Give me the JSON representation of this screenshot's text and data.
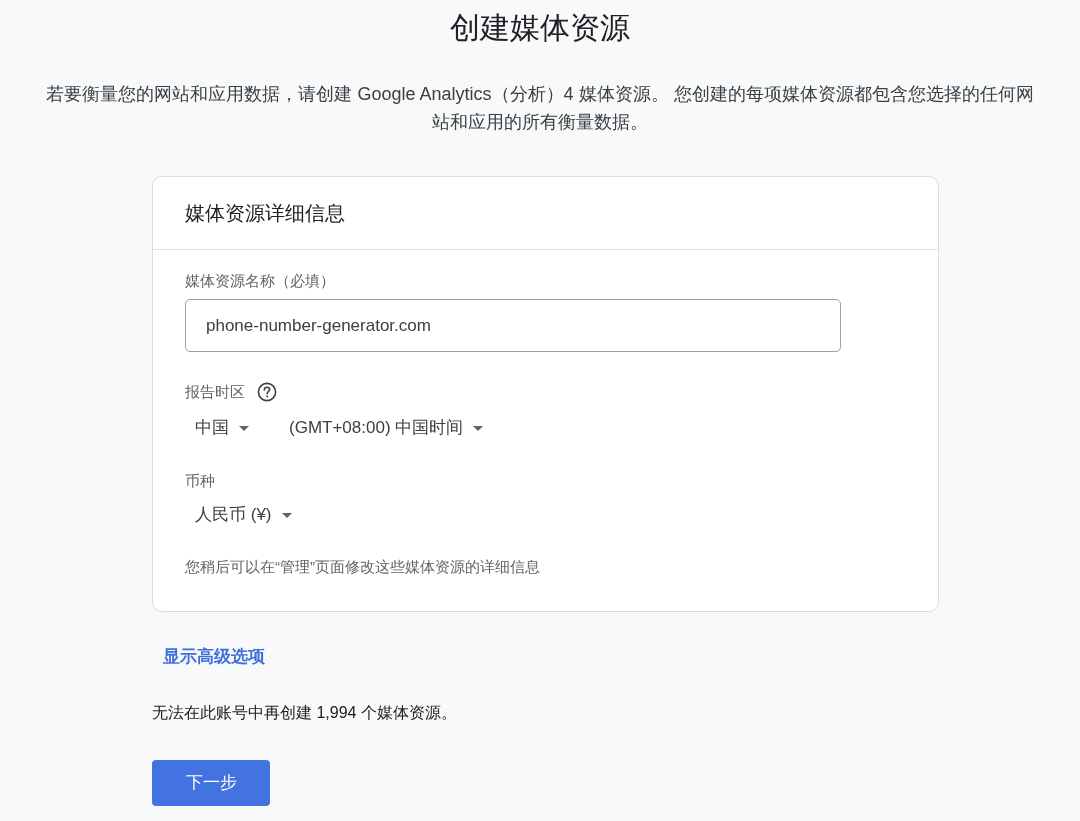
{
  "page": {
    "title": "创建媒体资源",
    "description": "若要衡量您的网站和应用数据，请创建 Google Analytics（分析）4 媒体资源。 您创建的每项媒体资源都包含您选择的任何网站和应用的所有衡量数据。"
  },
  "card": {
    "title": "媒体资源详细信息",
    "property_name": {
      "label": "媒体资源名称（必填）",
      "value": "phone-number-generator.com"
    },
    "time_zone": {
      "label": "报告时区",
      "country": "中国",
      "zone": "(GMT+08:00) 中国时间"
    },
    "currency": {
      "label": "币种",
      "value": "人民币 (¥)"
    },
    "note": "您稍后可以在“管理”页面修改这些媒体资源的详细信息"
  },
  "advanced_link": "显示高级选项",
  "quota_note": "无法在此账号中再创建 1,994 个媒体资源。",
  "next_button": "下一步"
}
